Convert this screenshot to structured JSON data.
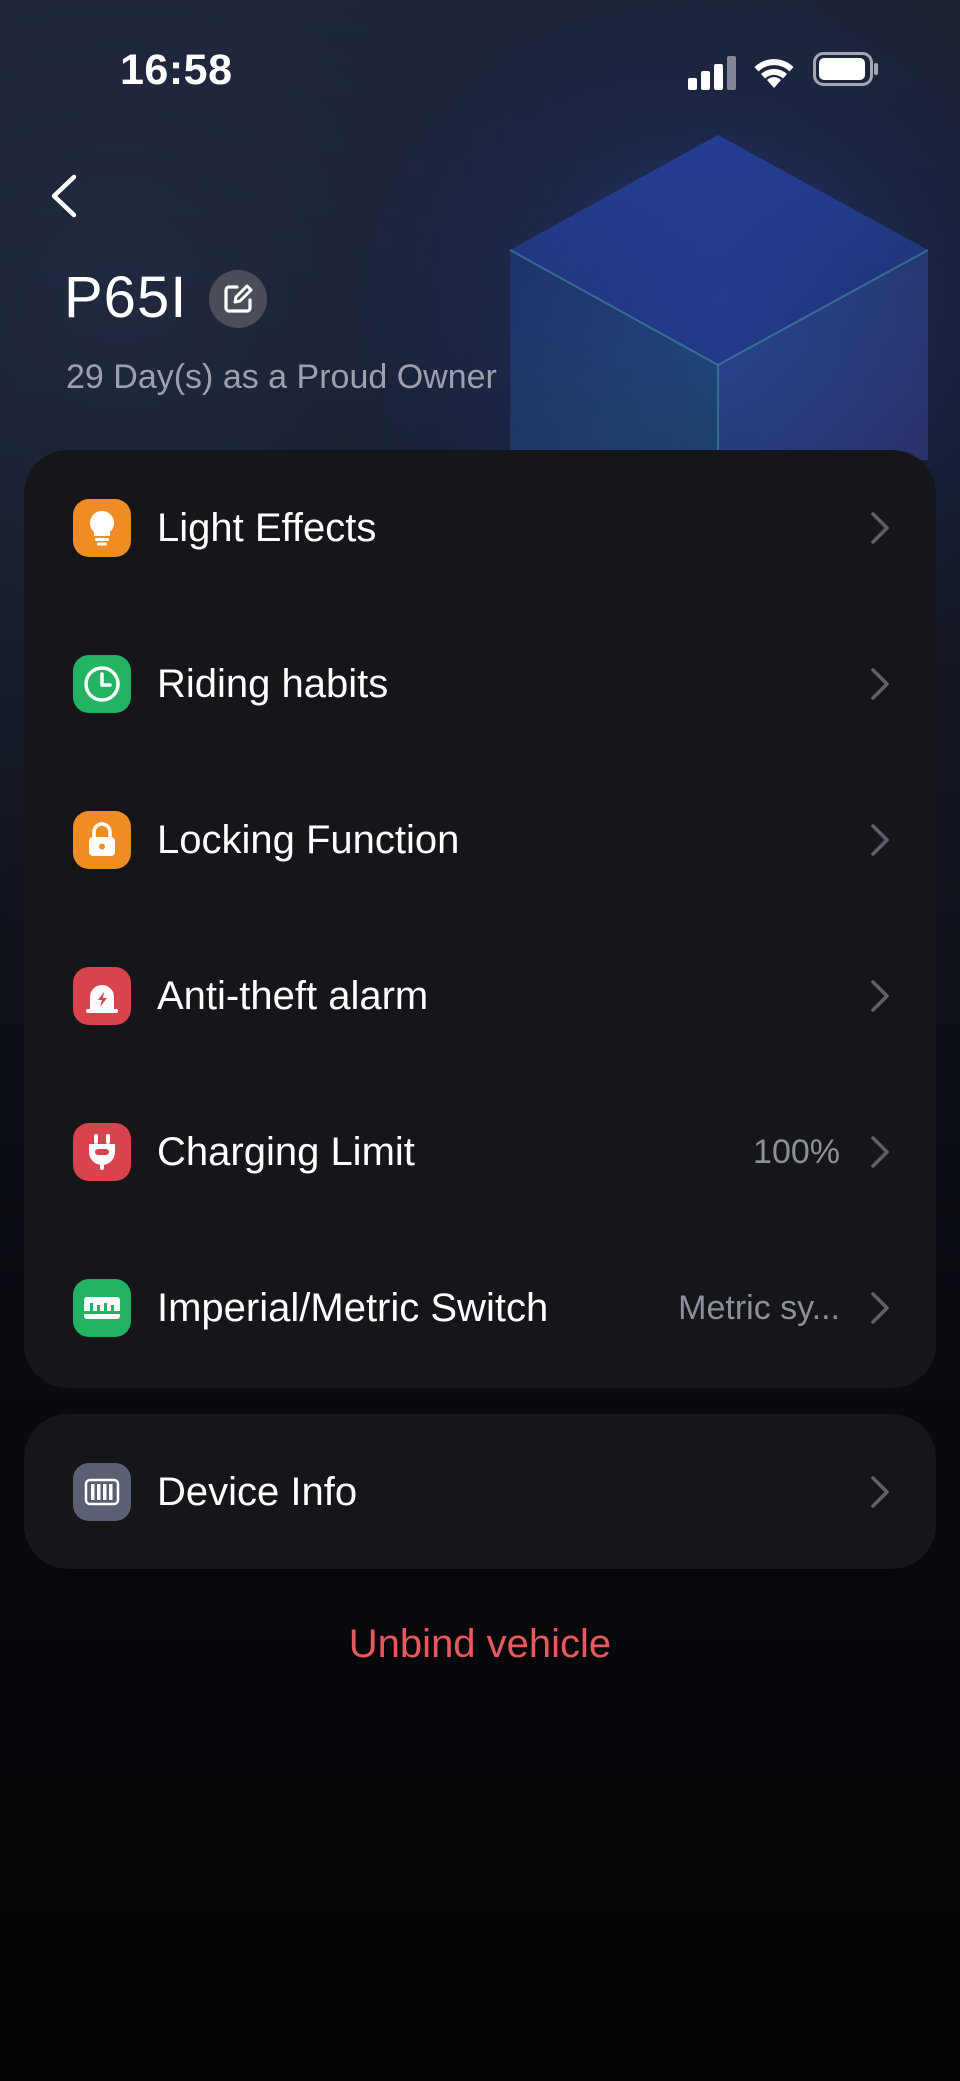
{
  "status_bar": {
    "time": "16:58",
    "icons": [
      "signal-icon",
      "wifi-icon",
      "battery-icon"
    ]
  },
  "header": {
    "back_icon": "chevron-left-icon",
    "vehicle_name": "P65I",
    "edit_icon": "edit-icon",
    "owner_subtitle": "29 Day(s) as a Proud Owner"
  },
  "settings": {
    "items": [
      {
        "label": "Light Effects",
        "icon": "lightbulb-icon",
        "icon_color": "#f08c24",
        "value": ""
      },
      {
        "label": "Riding habits",
        "icon": "clock-icon",
        "icon_color": "#22b463",
        "value": ""
      },
      {
        "label": "Locking Function",
        "icon": "lock-icon",
        "icon_color": "#f08c24",
        "value": ""
      },
      {
        "label": "Anti-theft alarm",
        "icon": "alarm-icon",
        "icon_color": "#d9434b",
        "value": ""
      },
      {
        "label": "Charging Limit",
        "icon": "plug-icon",
        "icon_color": "#d9434b",
        "value": "100%"
      },
      {
        "label": "Imperial/Metric Switch",
        "icon": "ruler-icon",
        "icon_color": "#22b463",
        "value": "Metric sy..."
      }
    ]
  },
  "device": {
    "label": "Device Info",
    "icon": "barcode-icon",
    "icon_color": "#5a5f74"
  },
  "unbind_label": "Unbind vehicle",
  "colors": {
    "accent_danger": "#e9585e",
    "card_background": "#151619",
    "secondary_text": "#8c909a"
  }
}
